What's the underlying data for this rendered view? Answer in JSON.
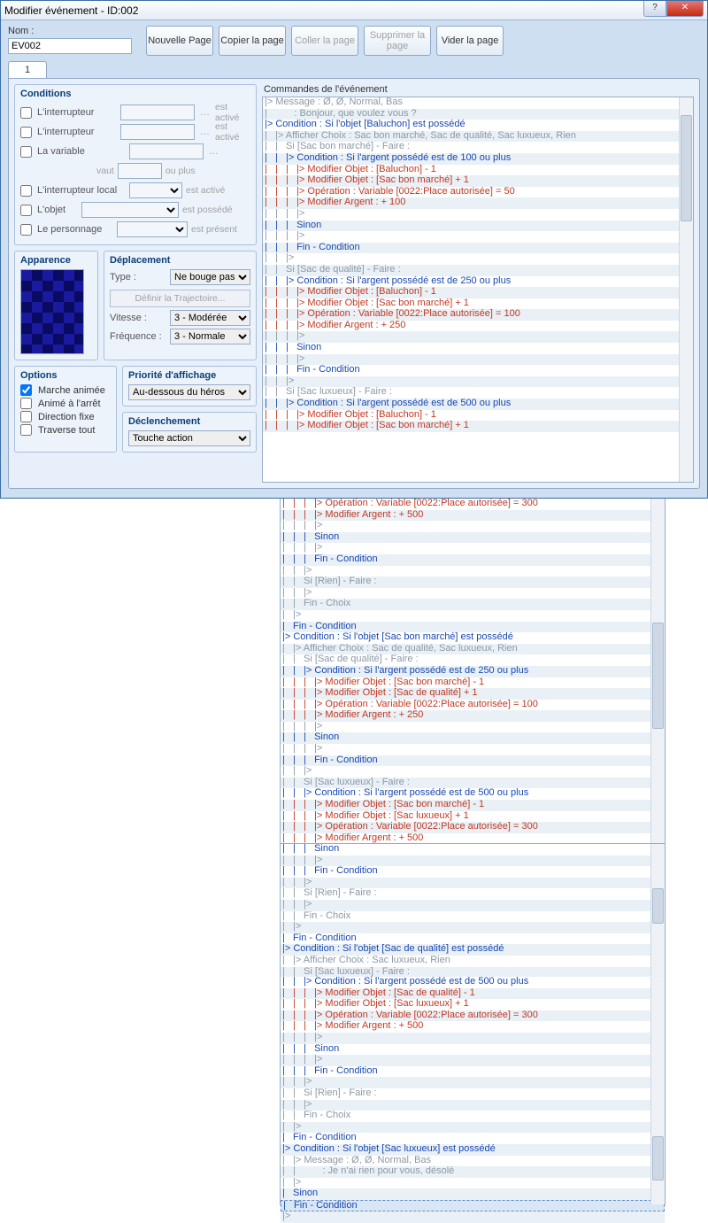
{
  "window": {
    "title": "Modifier événement - ID:002"
  },
  "name": {
    "label": "Nom :",
    "value": "EV002"
  },
  "toolbar": {
    "new_page": "Nouvelle\nPage",
    "copy_page": "Copier\nla page",
    "paste_page": "Coller\nla page",
    "delete_page": "Supprimer\nla page",
    "clear_page": "Vider\nla page"
  },
  "tab": {
    "label": "1"
  },
  "groups": {
    "conditions": "Conditions",
    "appearance": "Apparence",
    "movement": "Déplacement",
    "options": "Options",
    "priority": "Priorité d'affichage",
    "trigger": "Déclenchement",
    "commands": "Commandes de l'événement"
  },
  "conditions": {
    "switch1": {
      "label": "L'interrupteur",
      "suffix": "est activé"
    },
    "switch2": {
      "label": "L'interrupteur",
      "suffix": "est activé"
    },
    "variable": {
      "label": "La variable",
      "sub1": "vaut",
      "sub2": "ou plus"
    },
    "self_switch": {
      "label": "L'interrupteur local",
      "suffix": "est activé"
    },
    "item": {
      "label": "L'objet",
      "suffix": "est possédé"
    },
    "actor": {
      "label": "Le personnage",
      "suffix": "est présent"
    }
  },
  "movement": {
    "type_label": "Type :",
    "type_value": "Ne bouge pas",
    "trajectory": "Définir la Trajectoire...",
    "speed_label": "Vitesse :",
    "speed_value": "3 - Modérée",
    "freq_label": "Fréquence :",
    "freq_value": "3 - Normale"
  },
  "options": {
    "walk_anim": "Marche animée",
    "step_anim": "Animé à l'arrêt",
    "dir_fix": "Direction fixe",
    "through": "Traverse tout"
  },
  "priority": {
    "value": "Au-dessous du héros"
  },
  "trigger": {
    "value": "Touche action"
  },
  "cmds": [
    {
      "d": 0,
      "c": "gray",
      "t": "|> Message : Ø, Ø, Normal, Bas"
    },
    {
      "d": 0,
      "c": "gray",
      "t": "|          : Bonjour, que voulez vous ?"
    },
    {
      "d": 0,
      "c": "blue",
      "t": "|> Condition : Si l'objet [Baluchon] est possédé"
    },
    {
      "d": 1,
      "c": "gray",
      "t": "|> Afficher Choix : Sac bon marché, Sac de qualité, Sac luxueux, Rien"
    },
    {
      "d": 1,
      "c": "gray",
      "t": "|   Si [Sac bon marché] - Faire :"
    },
    {
      "d": 2,
      "c": "blue",
      "t": "|> Condition : Si l'argent possédé est de 100 ou plus"
    },
    {
      "d": 3,
      "c": "red",
      "t": "|> Modifier Objet : [Baluchon] - 1"
    },
    {
      "d": 3,
      "c": "red",
      "t": "|> Modifier Objet : [Sac bon marché] + 1"
    },
    {
      "d": 3,
      "c": "red",
      "t": "|> Opération : Variable [0022:Place autorisée] = 50"
    },
    {
      "d": 3,
      "c": "red",
      "t": "|> Modifier Argent : + 100"
    },
    {
      "d": 3,
      "c": "gray",
      "t": "|>"
    },
    {
      "d": 2,
      "c": "blue",
      "t": "|   Sinon"
    },
    {
      "d": 3,
      "c": "gray",
      "t": "|>"
    },
    {
      "d": 2,
      "c": "blue",
      "t": "|   Fin - Condition"
    },
    {
      "d": 2,
      "c": "gray",
      "t": "|>"
    },
    {
      "d": 1,
      "c": "gray",
      "t": "|   Si [Sac de qualité] - Faire :"
    },
    {
      "d": 2,
      "c": "blue",
      "t": "|> Condition : Si l'argent possédé est de 250 ou plus"
    },
    {
      "d": 3,
      "c": "red",
      "t": "|> Modifier Objet : [Baluchon] - 1"
    },
    {
      "d": 3,
      "c": "red",
      "t": "|> Modifier Objet : [Sac bon marché] + 1"
    },
    {
      "d": 3,
      "c": "red",
      "t": "|> Opération : Variable [0022:Place autorisée] = 100"
    },
    {
      "d": 3,
      "c": "red",
      "t": "|> Modifier Argent : + 250"
    },
    {
      "d": 3,
      "c": "gray",
      "t": "|>"
    },
    {
      "d": 2,
      "c": "blue",
      "t": "|   Sinon"
    },
    {
      "d": 3,
      "c": "gray",
      "t": "|>"
    },
    {
      "d": 2,
      "c": "blue",
      "t": "|   Fin - Condition"
    },
    {
      "d": 2,
      "c": "gray",
      "t": "|>"
    },
    {
      "d": 1,
      "c": "gray",
      "t": "|   Si [Sac luxueux] - Faire :"
    },
    {
      "d": 2,
      "c": "blue",
      "t": "|> Condition : Si l'argent possédé est de 500 ou plus"
    },
    {
      "d": 3,
      "c": "red",
      "t": "|> Modifier Objet : [Baluchon] - 1"
    },
    {
      "d": 3,
      "c": "red",
      "t": "|> Modifier Objet : [Sac bon marché] + 1"
    },
    {
      "d": 3,
      "c": "red",
      "t": "|> Opération : Variable [0022:Place autorisée] = 300"
    },
    {
      "d": 3,
      "c": "red",
      "t": "|> Modifier Argent : + 500"
    },
    {
      "d": 3,
      "c": "gray",
      "t": "|>"
    },
    {
      "d": 2,
      "c": "blue",
      "t": "|   Sinon"
    },
    {
      "d": 3,
      "c": "gray",
      "t": "|>"
    },
    {
      "d": 2,
      "c": "blue",
      "t": "|   Fin - Condition"
    },
    {
      "d": 2,
      "c": "gray",
      "t": "|>"
    },
    {
      "d": 1,
      "c": "gray",
      "t": "|   Si [Rien] - Faire :"
    },
    {
      "d": 2,
      "c": "gray",
      "t": "|>"
    },
    {
      "d": 1,
      "c": "gray",
      "t": "|   Fin - Choix"
    },
    {
      "d": 1,
      "c": "gray",
      "t": "|>"
    },
    {
      "d": 0,
      "c": "blue",
      "t": "|   Fin - Condition"
    },
    {
      "d": 0,
      "c": "blue",
      "t": "|> Condition : Si l'objet [Sac bon marché] est possédé"
    },
    {
      "d": 1,
      "c": "gray",
      "t": "|> Afficher Choix : Sac de qualité, Sac luxueux, Rien"
    },
    {
      "d": 1,
      "c": "gray",
      "t": "|   Si [Sac de qualité] - Faire :"
    },
    {
      "d": 2,
      "c": "blue",
      "t": "|> Condition : Si l'argent possédé est de 250 ou plus"
    },
    {
      "d": 3,
      "c": "red",
      "t": "|> Modifier Objet : [Sac bon marché] - 1"
    },
    {
      "d": 3,
      "c": "red",
      "t": "|> Modifier Objet : [Sac de qualité] + 1"
    },
    {
      "d": 3,
      "c": "red",
      "t": "|> Opération : Variable [0022:Place autorisée] = 100"
    },
    {
      "d": 3,
      "c": "red",
      "t": "|> Modifier Argent : + 250"
    },
    {
      "d": 3,
      "c": "gray",
      "t": "|>"
    },
    {
      "d": 2,
      "c": "blue",
      "t": "|   Sinon"
    },
    {
      "d": 3,
      "c": "gray",
      "t": "|>"
    },
    {
      "d": 2,
      "c": "blue",
      "t": "|   Fin - Condition"
    },
    {
      "d": 2,
      "c": "gray",
      "t": "|>"
    },
    {
      "d": 1,
      "c": "gray",
      "t": "|   Si [Sac luxueux] - Faire :"
    },
    {
      "d": 2,
      "c": "blue",
      "t": "|> Condition : Si l'argent possédé est de 500 ou plus"
    },
    {
      "d": 3,
      "c": "red",
      "t": "|> Modifier Objet : [Sac bon marché] - 1"
    },
    {
      "d": 3,
      "c": "red",
      "t": "|> Modifier Objet : [Sac luxueux] + 1"
    },
    {
      "d": 3,
      "c": "red",
      "t": "|> Opération : Variable [0022:Place autorisée] = 300"
    },
    {
      "d": 3,
      "c": "red",
      "t": "|> Modifier Argent : + 500"
    },
    {
      "d": 3,
      "c": "gray",
      "t": "|>"
    },
    {
      "d": 2,
      "c": "blue",
      "t": "|   Sinon"
    },
    {
      "d": 3,
      "c": "gray",
      "t": "|>"
    },
    {
      "d": 2,
      "c": "blue",
      "t": "|   Fin - Condition"
    },
    {
      "d": 2,
      "c": "gray",
      "t": "|>"
    },
    {
      "d": 1,
      "c": "gray",
      "t": "|   Si [Rien] - Faire :"
    },
    {
      "d": 2,
      "c": "gray",
      "t": "|>"
    },
    {
      "d": 1,
      "c": "gray",
      "t": "|   Fin - Choix"
    },
    {
      "d": 1,
      "c": "gray",
      "t": "|>"
    },
    {
      "d": 0,
      "c": "blue",
      "t": "|   Fin - Condition"
    },
    {
      "d": 0,
      "c": "blue",
      "t": "|> Condition : Si l'objet [Sac de qualité] est possédé"
    },
    {
      "d": 1,
      "c": "gray",
      "t": "|> Afficher Choix : Sac luxueux, Rien"
    },
    {
      "d": 1,
      "c": "gray",
      "t": "|   Si [Sac luxueux] - Faire :"
    },
    {
      "d": 2,
      "c": "blue",
      "t": "|> Condition : Si l'argent possédé est de 500 ou plus"
    },
    {
      "d": 3,
      "c": "red",
      "t": "|> Modifier Objet : [Sac de qualité] - 1"
    },
    {
      "d": 3,
      "c": "red",
      "t": "|> Modifier Objet : [Sac luxueux] + 1"
    },
    {
      "d": 3,
      "c": "red",
      "t": "|> Opération : Variable [0022:Place autorisée] = 300"
    },
    {
      "d": 3,
      "c": "red",
      "t": "|> Modifier Argent : + 500"
    },
    {
      "d": 3,
      "c": "gray",
      "t": "|>"
    },
    {
      "d": 2,
      "c": "blue",
      "t": "|   Sinon"
    },
    {
      "d": 3,
      "c": "gray",
      "t": "|>"
    },
    {
      "d": 2,
      "c": "blue",
      "t": "|   Fin - Condition"
    },
    {
      "d": 2,
      "c": "gray",
      "t": "|>"
    },
    {
      "d": 1,
      "c": "gray",
      "t": "|   Si [Rien] - Faire :"
    },
    {
      "d": 2,
      "c": "gray",
      "t": "|>"
    },
    {
      "d": 1,
      "c": "gray",
      "t": "|   Fin - Choix"
    },
    {
      "d": 1,
      "c": "gray",
      "t": "|>"
    },
    {
      "d": 0,
      "c": "blue",
      "t": "|   Fin - Condition"
    },
    {
      "d": 0,
      "c": "blue",
      "t": "|> Condition : Si l'objet [Sac luxueux] est possédé"
    },
    {
      "d": 1,
      "c": "gray",
      "t": "|> Message : Ø, Ø, Normal, Bas"
    },
    {
      "d": 1,
      "c": "gray",
      "t": "|          : Je n'ai rien pour vous, désolé"
    },
    {
      "d": 1,
      "c": "gray",
      "t": "|>"
    },
    {
      "d": 0,
      "c": "blue",
      "t": "|   Sinon"
    },
    {
      "d": 0,
      "c": "blue",
      "t": "|   Fin - Condition",
      "sel": true
    },
    {
      "d": 0,
      "c": "gray",
      "t": "|>"
    }
  ],
  "split_points": [
    30,
    62,
    74
  ]
}
